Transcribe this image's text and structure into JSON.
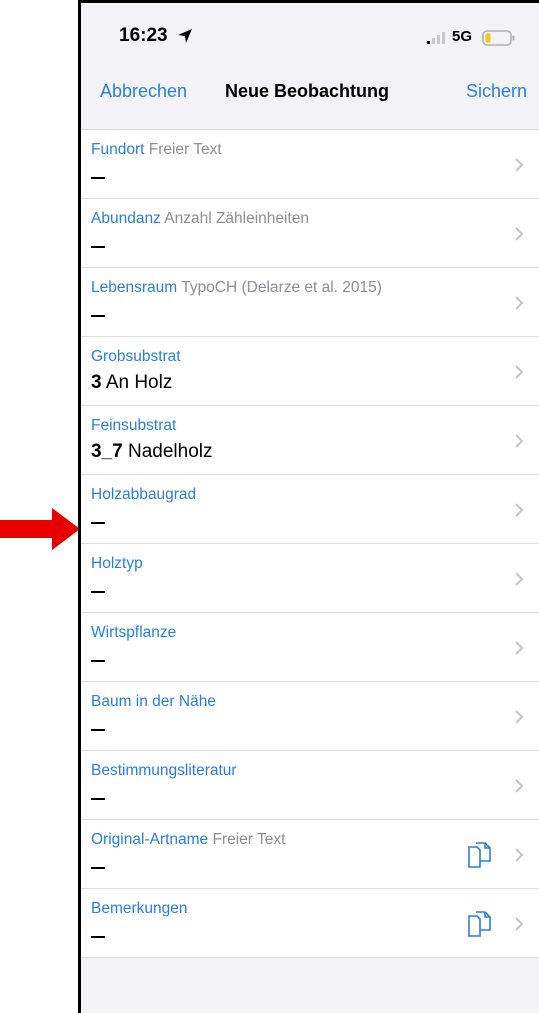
{
  "statusbar": {
    "time": "16:23",
    "network": "5G",
    "location_icon": "location-arrow-icon",
    "signal_icon": "signal-bars-icon",
    "battery_icon": "battery-low-icon"
  },
  "nav": {
    "cancel": "Abbrechen",
    "title": "Neue Beobachtung",
    "save": "Sichern"
  },
  "colors": {
    "accent": "#2a7fd8",
    "hint": "#8e8e93",
    "arrow": "#e60000",
    "battery_low": "#f5c518"
  },
  "rows": [
    {
      "label": "Fundort",
      "hint": "Freier Text",
      "value": "—"
    },
    {
      "label": "Abundanz",
      "hint": "Anzahl Zähleinheiten",
      "value": "—"
    },
    {
      "label": "Lebensraum",
      "hint": "TypoCH (Delarze et al. 2015)",
      "value": "—"
    },
    {
      "label": "Grobsubstrat",
      "hint": "",
      "code": "3",
      "value": "An Holz"
    },
    {
      "label": "Feinsubstrat",
      "hint": "",
      "code": "3_7",
      "value": "Nadelholz"
    },
    {
      "label": "Holzabbaugrad",
      "hint": "",
      "value": "—"
    },
    {
      "label": "Holztyp",
      "hint": "",
      "value": "—"
    },
    {
      "label": "Wirtspflanze",
      "hint": "",
      "value": "—"
    },
    {
      "label": "Baum in der Nähe",
      "hint": "",
      "value": "—"
    },
    {
      "label": "Bestimmungsliteratur",
      "hint": "",
      "value": "—"
    },
    {
      "label": "Original-Artname",
      "hint": "Freier Text",
      "value": "—",
      "icon": "copy-icon"
    },
    {
      "label": "Bemerkungen",
      "hint": "",
      "value": "—",
      "icon": "copy-icon"
    }
  ]
}
